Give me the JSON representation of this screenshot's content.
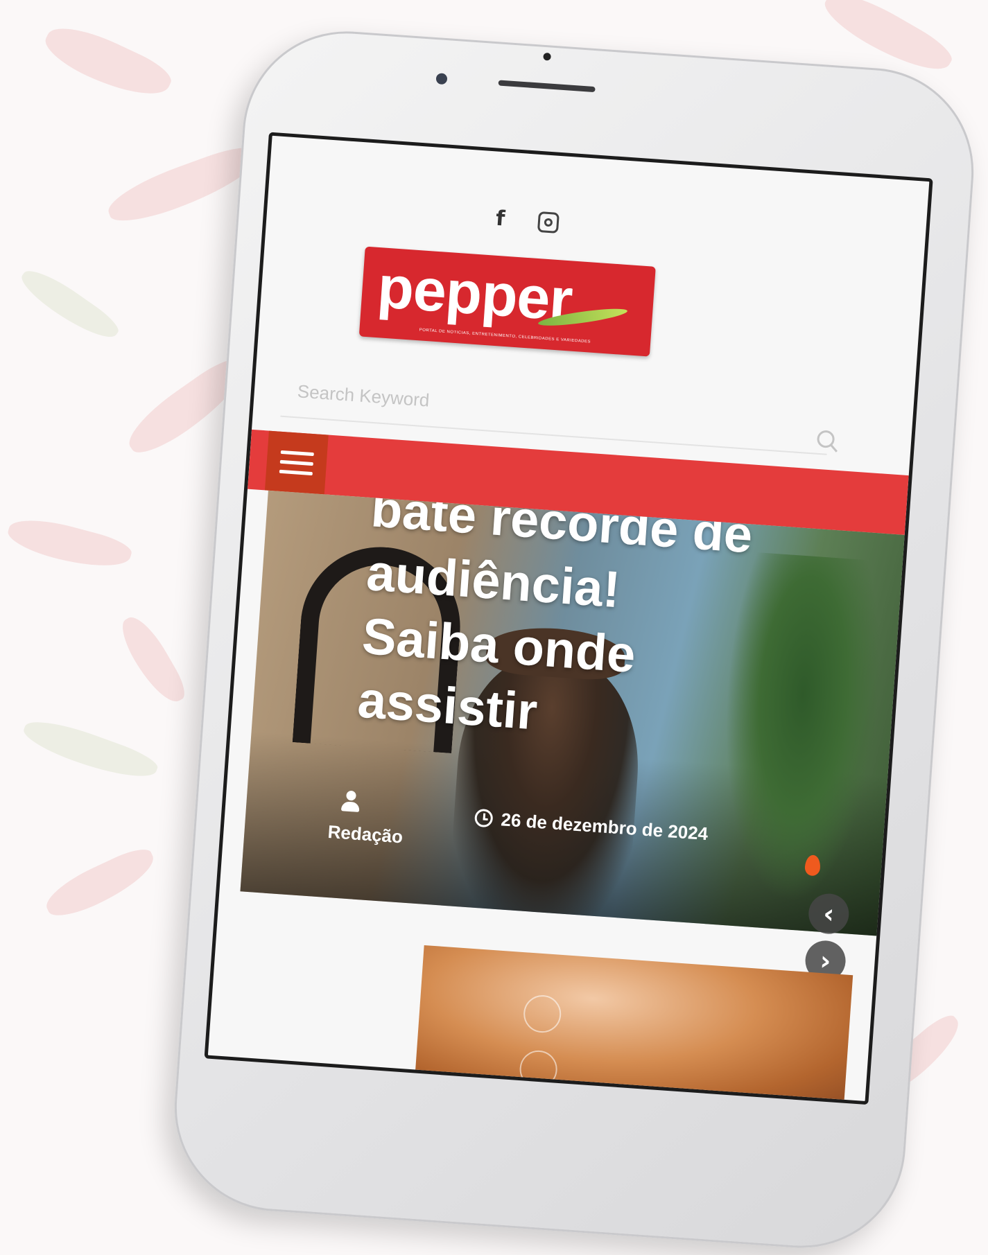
{
  "social": {
    "facebook_icon": "f"
  },
  "logo": {
    "name": "pepper",
    "tagline": "PORTAL DE NOTÍCIAS, ENTRETENIMENTO, CELEBRIDADES E VARIEDADES"
  },
  "search": {
    "placeholder": "Search Keyword"
  },
  "hero": {
    "title": "bate recorde de\naudiência!\nSaiba onde\nassistir",
    "author": "Redação",
    "date": "26 de dezembro de 2024"
  },
  "slider": {
    "prev_symbol": "‹",
    "next_symbol": "›"
  },
  "colors": {
    "navbar": "#e43c3c",
    "logo_red": "#d7282e",
    "menu_button": "#c53a1d"
  }
}
